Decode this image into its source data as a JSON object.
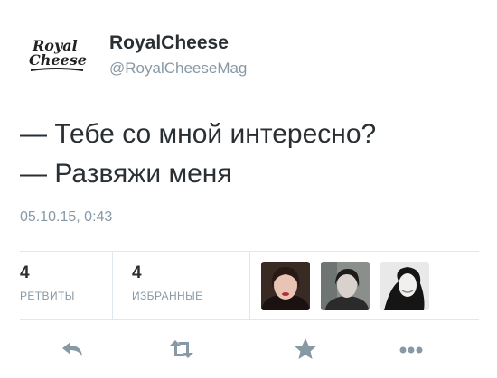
{
  "user": {
    "logo_text_line1": "Royal",
    "logo_text_line2": "Cheese",
    "name": "RoyalCheese",
    "handle": "@RoyalCheeseMag"
  },
  "tweet": {
    "lines": [
      "— Тебе со мной интересно?",
      "— Развяжи меня"
    ],
    "timestamp": "05.10.15, 0:43"
  },
  "stats": {
    "retweets_count": "4",
    "retweets_label": "РЕТВИТЫ",
    "favorites_count": "4",
    "favorites_label": "ИЗБРАННЫЕ"
  },
  "actions": [
    {
      "icon": "reply-icon"
    },
    {
      "icon": "retweet-icon"
    },
    {
      "icon": "star-icon"
    },
    {
      "icon": "more-icon"
    }
  ],
  "colors": {
    "primary_text": "#292f33",
    "secondary_text": "#8899a6",
    "divider": "#e1e8ed",
    "icon": "#8899a6"
  }
}
